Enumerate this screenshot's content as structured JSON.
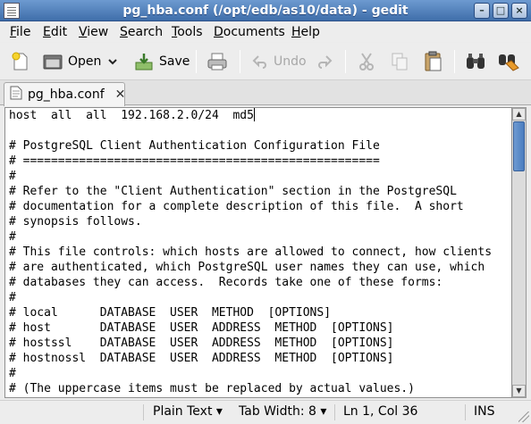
{
  "window": {
    "title": "pg_hba.conf (/opt/edb/as10/data) - gedit",
    "minimize": "–",
    "maximize": "□",
    "close": "×"
  },
  "menu": [
    {
      "label": "File",
      "accel": "F",
      "rest": "ile"
    },
    {
      "label": "Edit",
      "accel": "E",
      "rest": "dit"
    },
    {
      "label": "View",
      "accel": "V",
      "rest": "iew"
    },
    {
      "label": "Search",
      "accel": "S",
      "rest": "earch"
    },
    {
      "label": "Tools",
      "accel": "T",
      "rest": "ools"
    },
    {
      "label": "Documents",
      "accel": "D",
      "rest": "ocuments"
    },
    {
      "label": "Help",
      "accel": "H",
      "rest": "elp"
    }
  ],
  "toolbar": {
    "open": "Open",
    "save": "Save",
    "undo": "Undo"
  },
  "tab": {
    "label": "pg_hba.conf",
    "close": "✕"
  },
  "editor": {
    "lines": [
      "host  all  all  192.168.2.0/24  md5",
      "",
      "# PostgreSQL Client Authentication Configuration File",
      "# ===================================================",
      "#",
      "# Refer to the \"Client Authentication\" section in the PostgreSQL",
      "# documentation for a complete description of this file.  A short",
      "# synopsis follows.",
      "#",
      "# This file controls: which hosts are allowed to connect, how clients",
      "# are authenticated, which PostgreSQL user names they can use, which",
      "# databases they can access.  Records take one of these forms:",
      "#",
      "# local      DATABASE  USER  METHOD  [OPTIONS]",
      "# host       DATABASE  USER  ADDRESS  METHOD  [OPTIONS]",
      "# hostssl    DATABASE  USER  ADDRESS  METHOD  [OPTIONS]",
      "# hostnossl  DATABASE  USER  ADDRESS  METHOD  [OPTIONS]",
      "#",
      "# (The uppercase items must be replaced by actual values.)"
    ]
  },
  "status": {
    "language": "Plain Text ▾",
    "tab_width": "Tab Width: 8 ▾",
    "position": "Ln 1, Col 36",
    "mode": "INS"
  },
  "colors": {
    "titlebar": "#3f6eaa",
    "scroll_thumb": "#4b7dbf"
  }
}
